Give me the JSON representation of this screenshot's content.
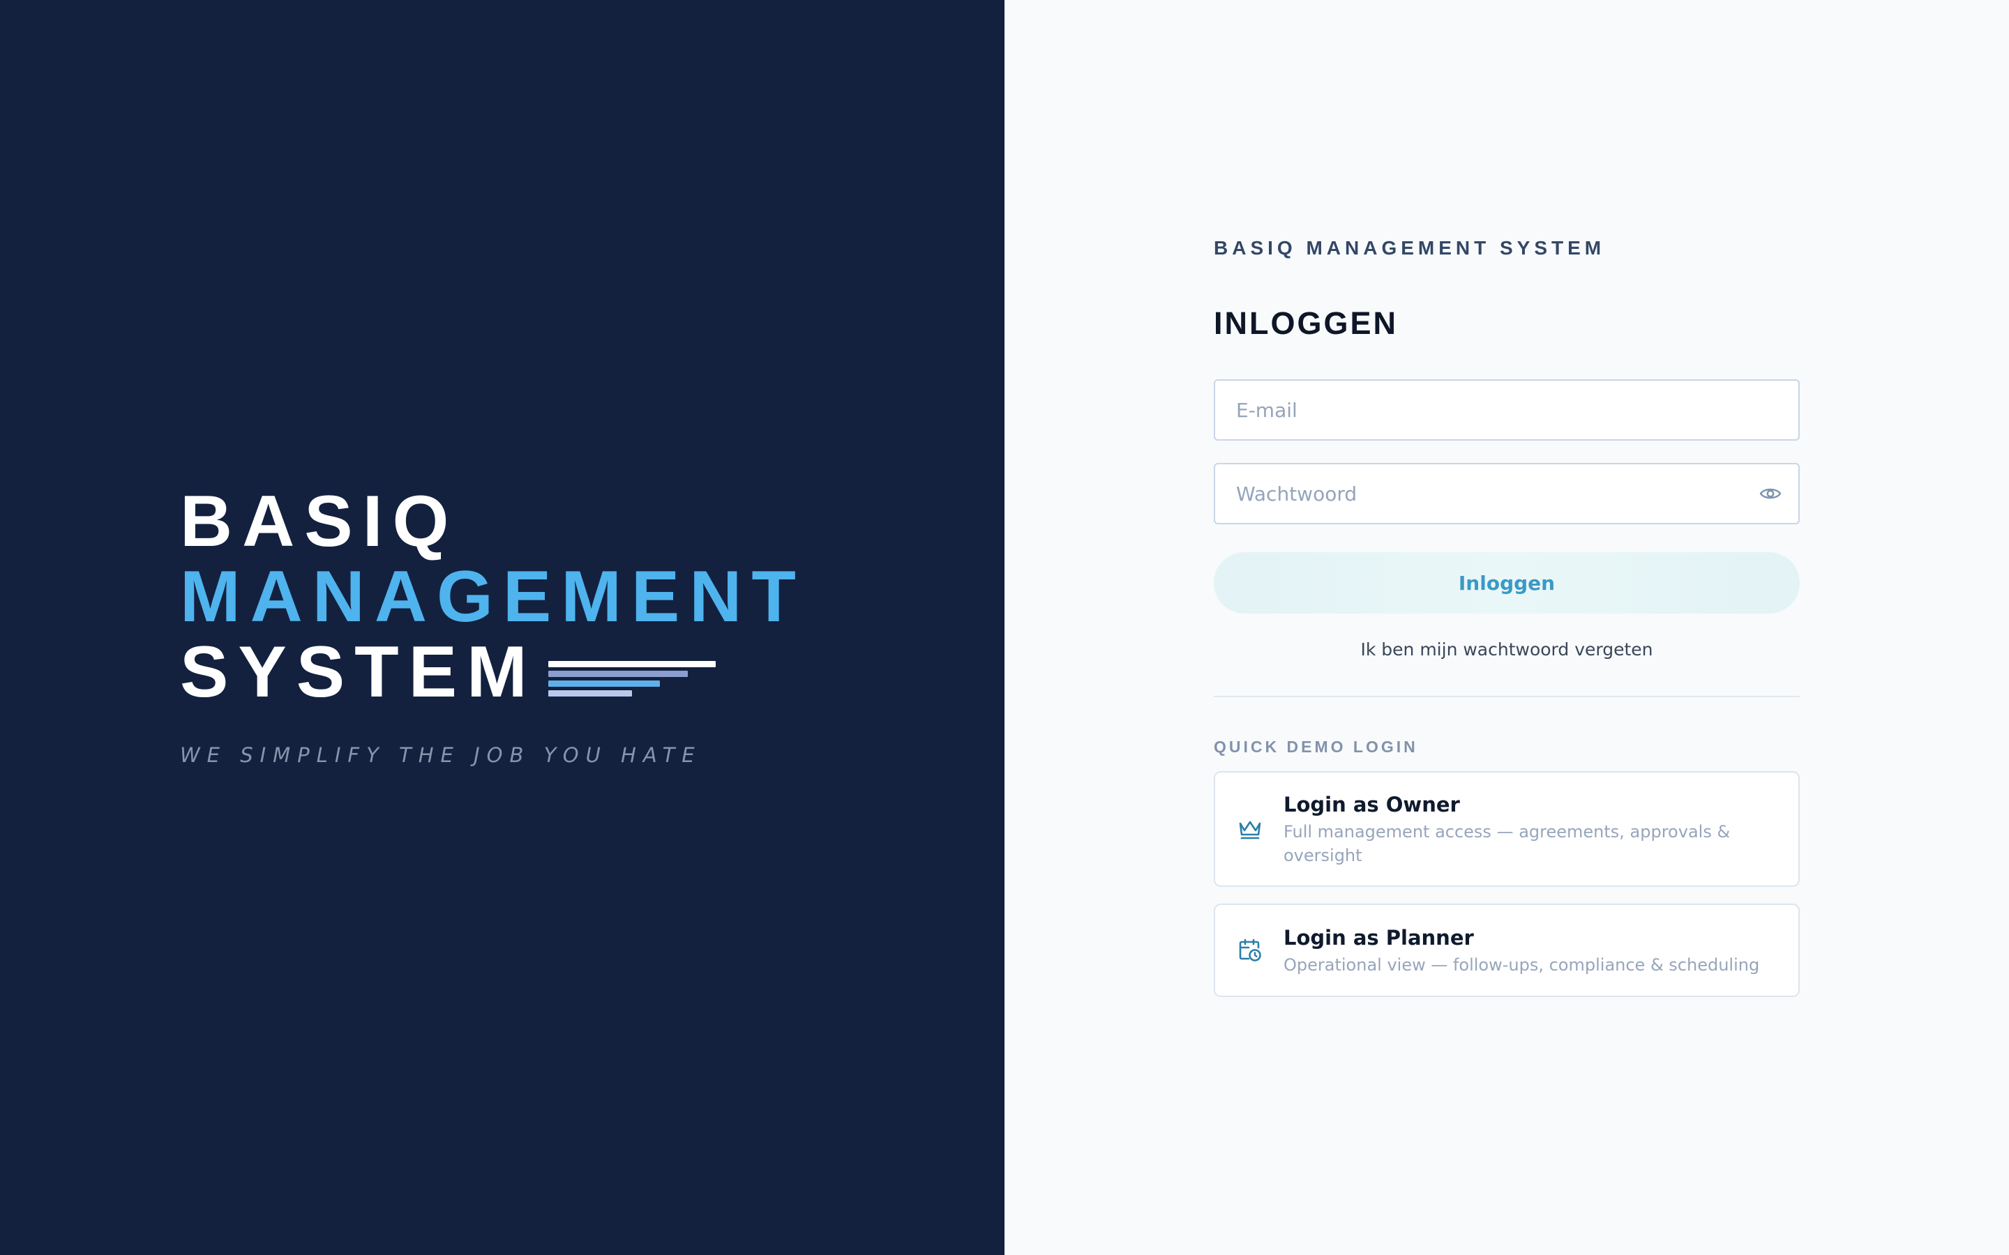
{
  "brand": {
    "line1": "BASIQ",
    "line2": "MANAGEMENT",
    "line3": "SYSTEM",
    "tagline": "WE SIMPLIFY THE JOB YOU HATE",
    "colors": {
      "panel_bg": "#13213f",
      "accent": "#4fb3ee",
      "text": "#ffffff",
      "speed_lines": [
        "#ffffff",
        "#8c9ed0",
        "#5fb0ea",
        "#b9c8ec"
      ]
    }
  },
  "login": {
    "kicker": "BASIQ MANAGEMENT SYSTEM",
    "title": "INLOGGEN",
    "email": {
      "placeholder": "E-mail",
      "value": ""
    },
    "password": {
      "placeholder": "Wachtwoord",
      "value": "",
      "toggle_icon": "eye-icon"
    },
    "submit_label": "Inloggen",
    "forgot_label": "Ik ben mijn wachtwoord vergeten",
    "colors": {
      "panel_bg": "#f8fafc",
      "button_text": "#3a9ac6",
      "button_bg": "#e6f5f7",
      "icon": "#2a7fa8"
    }
  },
  "demo": {
    "heading": "QUICK DEMO LOGIN",
    "options": [
      {
        "icon": "crown-icon",
        "title": "Login as Owner",
        "description": "Full management access — agreements, approvals & oversight"
      },
      {
        "icon": "calendar-clock-icon",
        "title": "Login as Planner",
        "description": "Operational view — follow-ups, compliance & scheduling"
      }
    ]
  }
}
